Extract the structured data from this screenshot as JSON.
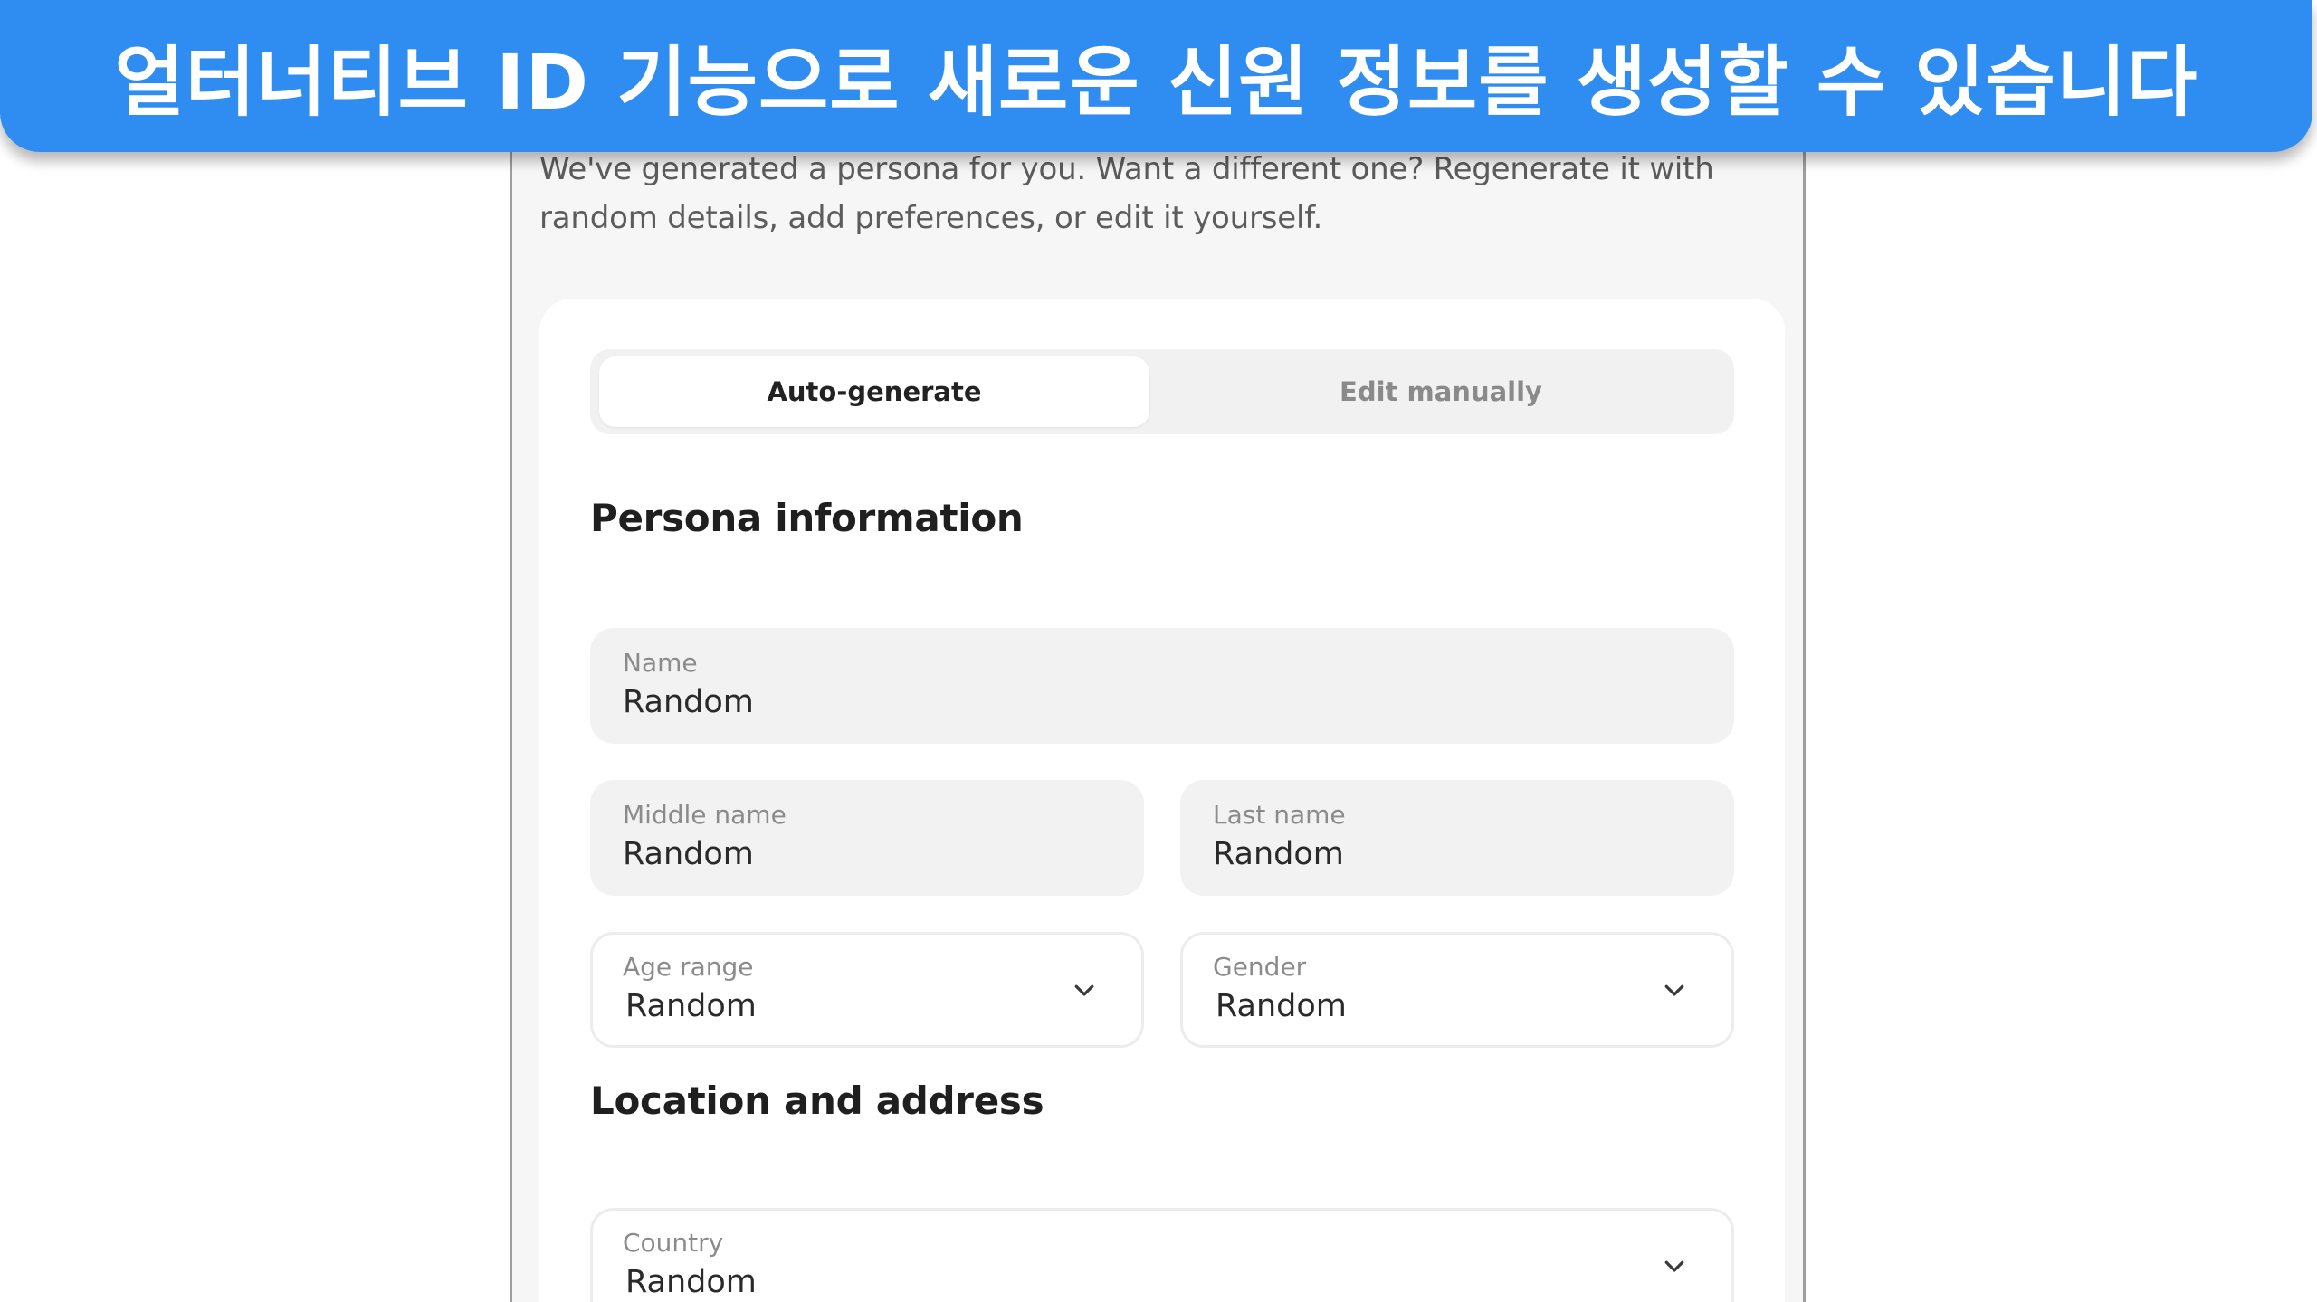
{
  "banner": {
    "text": "얼터너티브 ID 기능으로 새로운 신원 정보를 생성할 수 있습니다"
  },
  "intro": {
    "text": "We've generated a persona for you. Want a different one? Regenerate it with random details, add preferences, or edit it yourself."
  },
  "tabs": {
    "auto_generate": "Auto-generate",
    "edit_manually": "Edit manually",
    "active": "auto_generate"
  },
  "persona_section": {
    "title": "Persona information",
    "name": {
      "label": "Name",
      "value": "Random"
    },
    "middle_name": {
      "label": "Middle name",
      "value": "Random"
    },
    "last_name": {
      "label": "Last name",
      "value": "Random"
    },
    "age_range": {
      "label": "Age range",
      "value": "Random"
    },
    "gender": {
      "label": "Gender",
      "value": "Random"
    }
  },
  "location_section": {
    "title": "Location and address",
    "country": {
      "label": "Country",
      "value": "Random"
    }
  },
  "colors": {
    "banner": "#2f8cf0",
    "panel_bg": "#f6f6f6",
    "card_bg": "#ffffff",
    "field_bg": "#f2f2f2"
  },
  "icons": {
    "dropdown": "chevron-down-icon"
  }
}
